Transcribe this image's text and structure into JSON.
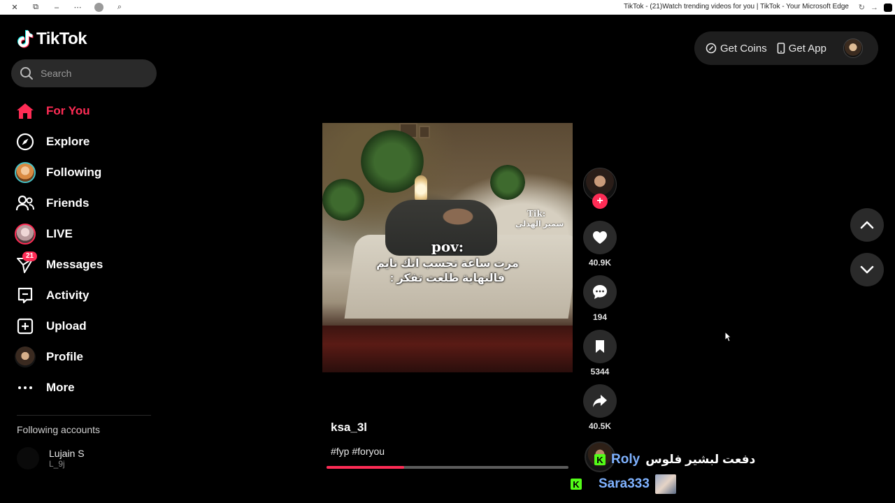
{
  "browser": {
    "title": "TikTok - (21)Watch trending videos for you | TikTok - Your Microsoft Edge"
  },
  "brand": {
    "name": "TikTok",
    "accent": "#fe2c55"
  },
  "search": {
    "placeholder": "Search"
  },
  "sidebar": {
    "items": [
      {
        "label": "For You",
        "icon": "home-icon",
        "active": true
      },
      {
        "label": "Explore",
        "icon": "compass-icon"
      },
      {
        "label": "Following",
        "icon": "following-avatar-icon"
      },
      {
        "label": "Friends",
        "icon": "friends-icon"
      },
      {
        "label": "LIVE",
        "icon": "live-avatar-icon"
      },
      {
        "label": "Messages",
        "icon": "send-icon",
        "badge": "21"
      },
      {
        "label": "Activity",
        "icon": "activity-icon"
      },
      {
        "label": "Upload",
        "icon": "upload-icon"
      },
      {
        "label": "Profile",
        "icon": "profile-avatar-icon"
      },
      {
        "label": "More",
        "icon": "more-icon"
      }
    ],
    "following_title": "Following accounts",
    "following": [
      {
        "name": "Lujain S",
        "handle": "L_9j"
      }
    ]
  },
  "topbar": {
    "coins": "Get Coins",
    "app": "Get App"
  },
  "video": {
    "overlay_tik": "Tik:",
    "overlay_name": "سمير الهذلي",
    "overlay_pov": "pov:",
    "overlay_line1": "مرت ساعة تحسب انك نايم",
    "overlay_line2": "فالنهاية طلعت تفكر :",
    "author": "ksa_3l",
    "caption": "#fyp #foryou",
    "progress": 0.32
  },
  "actions": {
    "likes": "40.9K",
    "comments": "194",
    "saves": "5344",
    "shares": "40.5K"
  },
  "stream_overlay": {
    "row1_user": "Roly",
    "row1_msg": "دفعت لبشير فلوس",
    "row2_user": "Sara333"
  }
}
